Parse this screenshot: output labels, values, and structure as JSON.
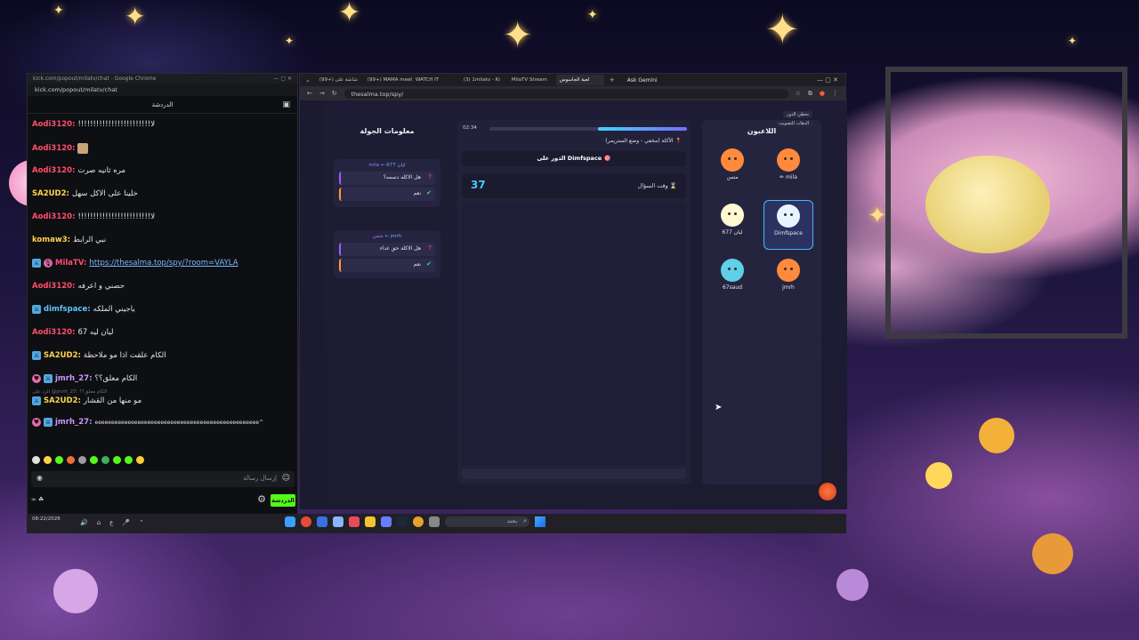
{
  "chat": {
    "window_title": "kick.com/popout/milatv/chat - Google Chrome",
    "url": "kick.com/popout/milatv/chat",
    "header_title": "الدردشة",
    "messages": [
      {
        "user": "Aodi3120:",
        "text": "!!!!!!!!!!!!!!!!!!!!!!!!لا",
        "color": "#ff4d6d"
      },
      {
        "user": "Aodi3120:",
        "text": "",
        "color": "#ff4d6d"
      },
      {
        "user": "Aodi3120:",
        "text": "مره ثانيه صرت",
        "color": "#ff4d6d"
      },
      {
        "user": "SA2UD2:",
        "text": "خلينا على الاكل سهل",
        "color": "#ffd24d"
      },
      {
        "user": "Aodi3120:",
        "text": "!!!!!!!!!!!!!!!!!!!!!!!!لا",
        "color": "#ff4d6d"
      },
      {
        "user": "komaw3:",
        "text": "نبي الرابط",
        "color": "#ffd24d"
      },
      {
        "user": "MilaTV:",
        "text": "https://thesalma.top/spy/?room=VAYLA",
        "color": "#ff4d6d"
      },
      {
        "user": "Aodi3120:",
        "text": "حصني و اعرفه",
        "color": "#ff4d6d"
      },
      {
        "user": "dimfspace:",
        "text": "ياجيني الملكه",
        "color": "#5fc3ff"
      },
      {
        "user": "Aodi3120:",
        "text": "ليان ليه 67",
        "color": "#ff4d6d"
      },
      {
        "user": "SA2UD2:",
        "text": "الكام علقت اذا مو ملاحظة",
        "color": "#ffd24d"
      },
      {
        "user": "jmrh_27:",
        "text": "الكام معلق؟؟",
        "color": "#c89bff"
      },
      {
        "user": "SA2UD2:",
        "text": "مو منها من القشار",
        "color": "#ffd24d"
      },
      {
        "user": "jmrh_27:",
        "text": "eeeeeeeeeeeeeeeeeeeeeeeeeeeeeeeeeeeeeeeeeeeeeeeeee^",
        "color": "#c89bff"
      }
    ],
    "reply_preview": "الرد على @jmrh_27: الكام معلق؟؟",
    "input_placeholder": "إرسال رسالة",
    "chat_button": "الدردشة",
    "footer_left": "∞ ☘"
  },
  "browser": {
    "tabs": [
      "(99+) شاشة على",
      "(99+) MAMA meet",
      "WATCH IT",
      "(3) 1milatv - Ki",
      "MilaTV Stream",
      "لعبة الجاسوس"
    ],
    "active_tab_index": 5,
    "ask_gemini": "Ask Gemini",
    "address": "thesalma.top/spy/"
  },
  "game": {
    "players_title": "اللاعبون",
    "skip_turn": "تخطي الدور",
    "vote_link": "الذهاب للتصويت",
    "players": [
      {
        "name": "mila",
        "prefix": "✏",
        "avatar_color": "#ff8a3c",
        "selected": false
      },
      {
        "name": "متمن",
        "prefix": "",
        "avatar_color": "#ff8a3c",
        "selected": false
      },
      {
        "name": "Dimfspace",
        "prefix": "",
        "avatar_color": "#e8f4ff",
        "selected": true
      },
      {
        "name": "ليان 677",
        "prefix": "",
        "avatar_color": "#fff8d0",
        "selected": false
      },
      {
        "name": "jmrh",
        "prefix": "",
        "avatar_color": "#ff8a3c",
        "selected": false
      },
      {
        "name": "67saud",
        "prefix": "",
        "avatar_color": "#5fd0e8",
        "selected": false
      }
    ],
    "timer_label": "02:34",
    "timer_progress_fraction": 0.45,
    "category_line": "الأكلة (مخفي - وضع الستريمر)",
    "turn_text": "الدور على Dimfspace",
    "question_time_value": "37",
    "question_time_label": "وقت السؤال",
    "round_title": "معلومات الجولة",
    "round_entries": [
      {
        "from": "mila",
        "to": "ليان 677",
        "question": "هل الاكله دسمه؟",
        "answer": "نعم"
      },
      {
        "from": "متمن",
        "to": "jmrh",
        "question": "هل الاكلة حق غداء",
        "answer": "نعم"
      }
    ]
  },
  "taskbar": {
    "time": "08:22/2026",
    "search_placeholder": "بحث",
    "lang": "ع"
  }
}
